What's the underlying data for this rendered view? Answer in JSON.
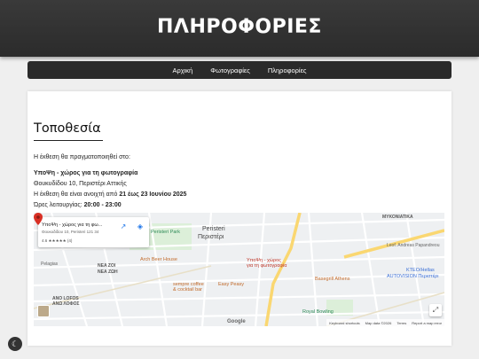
{
  "header": {
    "title": "ΠΛΗΡΟΦΟΡΙΕΣ"
  },
  "nav": {
    "items": [
      {
        "label": "Αρχική"
      },
      {
        "label": "Φωτογραφίες"
      },
      {
        "label": "Πληροφορίες"
      }
    ]
  },
  "content": {
    "section_title": "Τοποθεσία",
    "intro": "Η έκθεση θα πραγματοποιηθεί στο:",
    "venue_name": "ΥποΨη - χώρος για τη φωτογραφία",
    "address": "Θουκυδίδου 10, Περιστέρι Αττικής",
    "open_prefix": "Η έκθεση θα είναι ανοιχτή από ",
    "open_dates": "21 έως 23 Ιουνίου 2025",
    "hours_label": "Ώρες λειτουργίας: ",
    "hours_value": "20:00 - 23:00"
  },
  "map": {
    "info_name": "ΥποΨη - χώρος για τη φω...",
    "info_address": "Θουκυδίδου 10, Peristeri 121 34",
    "info_rating": "4.6 ★★★★★ (4)",
    "pin_label_line1": "ΥποΨη - χώρος",
    "pin_label_line2": "για τη φωτογραφία",
    "area_peristeri_en": "Peristeri",
    "area_peristeri_gr": "Περιστέρι",
    "area_nea_zoi_en": "NEA ZOI",
    "area_nea_zoi_gr": "ΝΕΑ ΖΩΗ",
    "area_anw_lofos_en": "ANO LOFOS",
    "area_anw_lofos_gr": "ΑΝΩ ΛΟΦΟΣ",
    "area_mykonos": "ΜΥΚΟΝΙΑΤΙΚΑ",
    "poi_park": "Peristeri Park",
    "poi_arch": "Arch Beer House",
    "poi_sempre": "sempre coffee",
    "poi_sempre2": "& cocktail bar",
    "poi_easy": "Easy Peasy",
    "poi_basegrill": "Basegrill Athens",
    "poi_royal": "Royal Bowling",
    "poi_ktel": "KTEO/Hellas",
    "poi_ktel2": "AUTOVISION Περιστέρι",
    "street_pelagias": "Pelagias",
    "street_leof": "Leof. Andreas Papandreou",
    "google": "Google",
    "attrib_keyboard": "Keyboard shortcuts",
    "attrib_data": "Map data ©2026",
    "attrib_terms": "Terms",
    "attrib_report": "Report a map error"
  },
  "icons": {
    "darkmode": "moon-icon",
    "pin": "map-pin-icon",
    "directions": "directions-icon",
    "open": "open-in-new-icon",
    "fullscreen": "fullscreen-icon",
    "pegman": "pegman-icon"
  }
}
